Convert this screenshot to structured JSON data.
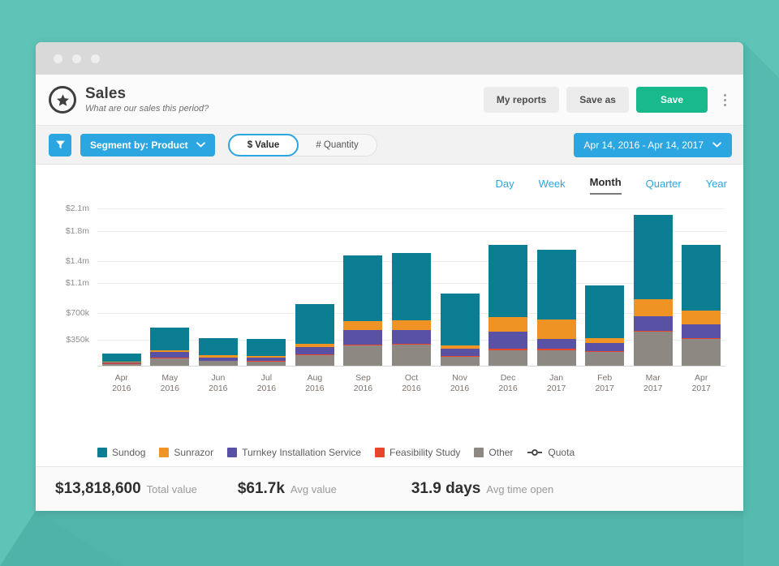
{
  "window": {
    "chrome_dots": [
      "dot-1",
      "dot-2",
      "dot-3"
    ]
  },
  "header": {
    "icon": "star-circle-icon",
    "title": "Sales",
    "subtitle": "What are our sales this period?",
    "buttons": [
      {
        "label": "My reports",
        "name": "my-reports-button",
        "style": "default"
      },
      {
        "label": "Save as",
        "name": "save-as-button",
        "style": "default"
      },
      {
        "label": "Save",
        "name": "save-button",
        "style": "primary"
      }
    ],
    "overflow_icon": "kebab-menu-icon"
  },
  "filter_bar": {
    "filter_icon": "funnel-icon",
    "segment": {
      "label": "Segment by: Product",
      "chevron": "chevron-down-icon"
    },
    "measure_toggle": {
      "options": [
        "$ Value",
        "# Quantity"
      ],
      "selected": "$ Value"
    },
    "date_range": {
      "label": "Apr 14, 2016 - Apr 14, 2017",
      "chevron": "chevron-down-icon"
    }
  },
  "granularity": {
    "options": [
      "Day",
      "Week",
      "Month",
      "Quarter",
      "Year"
    ],
    "selected": "Month"
  },
  "chart_data": {
    "type": "bar",
    "subtype": "stacked",
    "title": "Sales",
    "xlabel": "",
    "ylabel": "",
    "grid": true,
    "legend_position": "bottom",
    "ylim": [
      0,
      2275000
    ],
    "ytick_values": [
      350000,
      700000,
      1100000,
      1400000,
      1800000,
      2100000
    ],
    "ytick_labels": [
      "$350k",
      "$700k",
      "$1.1m",
      "$1.4m",
      "$1.8m",
      "$2.1m"
    ],
    "categories": [
      "Apr\n2016",
      "May\n2016",
      "Jun\n2016",
      "Jul\n2016",
      "Aug\n2016",
      "Sep\n2016",
      "Oct\n2016",
      "Nov\n2016",
      "Dec\n2016",
      "Jan\n2017",
      "Feb\n2017",
      "Mar\n2017",
      "Apr\n2017"
    ],
    "category_months": [
      "Apr",
      "May",
      "Jun",
      "Jul",
      "Aug",
      "Sep",
      "Oct",
      "Nov",
      "Dec",
      "Jan",
      "Feb",
      "Mar",
      "Apr"
    ],
    "category_years": [
      "2016",
      "2016",
      "2016",
      "2016",
      "2016",
      "2016",
      "2016",
      "2016",
      "2016",
      "2017",
      "2017",
      "2017",
      "2017"
    ],
    "series": [
      {
        "name": "Sundog",
        "color": "#0b7e94",
        "values": [
          105000,
          300000,
          230000,
          225000,
          530000,
          870000,
          900000,
          690000,
          970000,
          930000,
          700000,
          1130000,
          870000
        ]
      },
      {
        "name": "Sunrazor",
        "color": "#ef9324",
        "values": [
          12000,
          30000,
          28000,
          27000,
          40000,
          120000,
          130000,
          45000,
          195000,
          265000,
          70000,
          230000,
          190000
        ]
      },
      {
        "name": "Turnkey Installation Service",
        "color": "#5951a3",
        "values": [
          15000,
          70000,
          42000,
          40000,
          100000,
          195000,
          185000,
          95000,
          230000,
          130000,
          105000,
          190000,
          180000
        ]
      },
      {
        "name": "Feasibility Study",
        "color": "#e8462c",
        "values": [
          5000,
          10000,
          9000,
          9000,
          12000,
          15000,
          15000,
          12000,
          15000,
          15000,
          12000,
          15000,
          15000
        ]
      },
      {
        "name": "Other",
        "color": "#8e8882",
        "values": [
          23000,
          100000,
          61000,
          59000,
          138000,
          270000,
          280000,
          118000,
          210000,
          210000,
          183000,
          455000,
          355000
        ]
      }
    ],
    "quota": {
      "name": "Quota",
      "marker": "line-dot-marker",
      "color": "#3a3a3a"
    }
  },
  "footer_stats": [
    {
      "value": "$13,818,600",
      "label": "Total value",
      "name": "stat-total-value"
    },
    {
      "value": "$61.7k",
      "label": "Avg value",
      "name": "stat-avg-value"
    },
    {
      "value": "31.9 days",
      "label": "Avg time open",
      "name": "stat-avg-time-open"
    }
  ],
  "colors": {
    "background": "#5ec4b8",
    "accent_blue": "#2ba6e0",
    "accent_green": "#18b98b"
  }
}
